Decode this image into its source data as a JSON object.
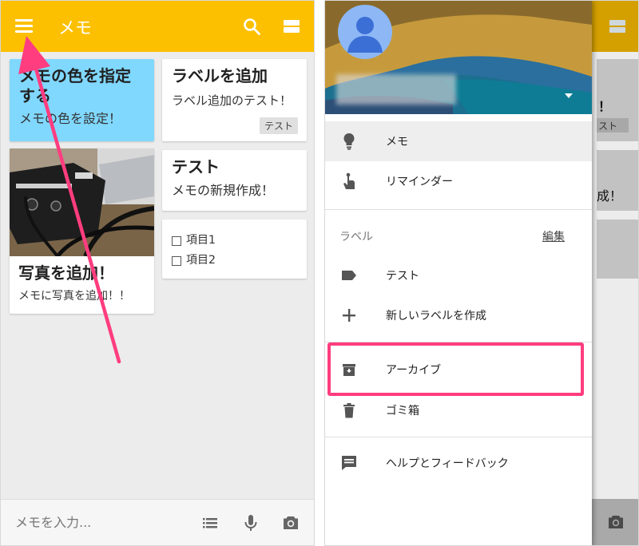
{
  "left": {
    "appbar": {
      "title": "メモ"
    },
    "notes": {
      "color": {
        "title": "メモの色を指定する",
        "body": "メモの色を設定！"
      },
      "label": {
        "title": "ラベルを追加",
        "body": "ラベル追加のテスト！",
        "chip": "テスト"
      },
      "new": {
        "title": "テスト",
        "body": "メモの新規作成！"
      },
      "checklist": {
        "items": [
          "項目1",
          "項目2"
        ]
      },
      "photo": {
        "title": "写真を追加！",
        "body": "メモに写真を追加！！"
      }
    },
    "bottombar": {
      "placeholder": "メモを入力..."
    }
  },
  "right": {
    "background": {
      "lines": [
        "！",
        "スト",
        "成！"
      ]
    },
    "drawer": {
      "items": {
        "notes": "メモ",
        "reminders": "リマインダー",
        "labels_header": "ラベル",
        "edit": "編集",
        "test": "テスト",
        "new_label": "新しいラベルを作成",
        "archive": "アーカイブ",
        "trash": "ゴミ箱",
        "help": "ヘルプとフィードバック"
      }
    }
  },
  "colors": {
    "appbar": "#fcc000",
    "note_blue": "#80d8ff",
    "highlight": "#ff3d7f"
  }
}
